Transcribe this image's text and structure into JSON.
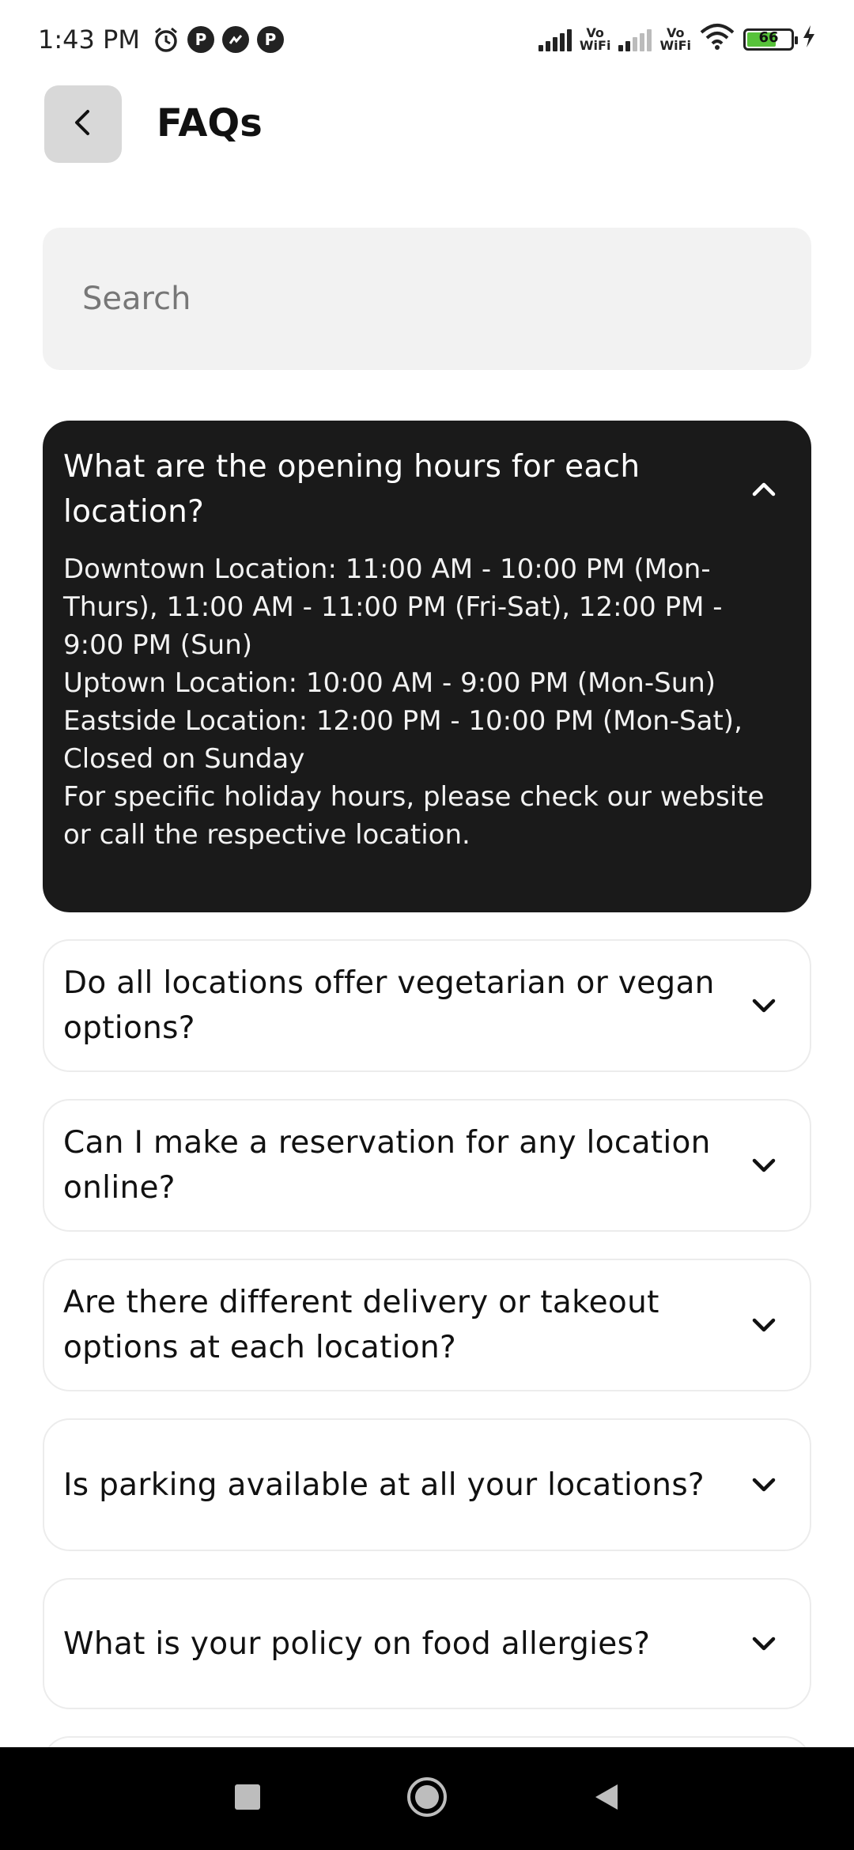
{
  "status_bar": {
    "time": "1:43 PM",
    "notification_letter": "P",
    "vowifi_top": "Vo",
    "vowifi_bottom": "WiFi",
    "battery": "66"
  },
  "header": {
    "title": "FAQs"
  },
  "search": {
    "placeholder": "Search"
  },
  "faqs": [
    {
      "question": "What are the opening hours for each location?",
      "expanded": true,
      "answer_lines": [
        "Downtown Location: 11:00 AM - 10:00 PM (Mon-Thurs), 11:00 AM - 11:00 PM (Fri-Sat), 12:00 PM - 9:00 PM (Sun)",
        "Uptown Location: 10:00 AM - 9:00 PM (Mon-Sun)",
        "Eastside Location: 12:00 PM - 10:00 PM (Mon-Sat), Closed on Sunday",
        "For specific holiday hours, please check our website or call the respective location."
      ]
    },
    {
      "question": "Do all locations offer vegetarian or vegan options?",
      "expanded": false
    },
    {
      "question": "Can I make a reservation for any location online?",
      "expanded": false
    },
    {
      "question": "Are there different delivery or takeout options at each location?",
      "expanded": false
    },
    {
      "question": "Is parking available at all your locations?",
      "expanded": false
    },
    {
      "question": "What is your policy on food allergies?",
      "expanded": false
    }
  ],
  "colors": {
    "expanded_card": "#1a1a1a",
    "search_bg": "#f2f2f2",
    "back_button_bg": "#d8d8d8",
    "battery_green": "#57c23a"
  },
  "icons": {
    "back": "chevron-left-icon",
    "expanded": "chevron-up-icon",
    "collapsed": "chevron-down-icon"
  }
}
